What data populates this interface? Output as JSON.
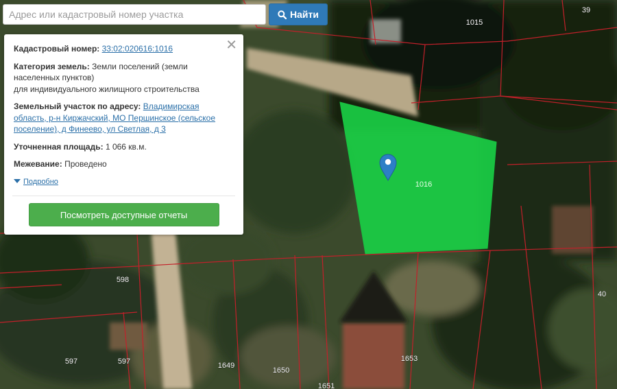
{
  "search": {
    "placeholder": "Адрес или кадастровый номер участка",
    "button_label": "Найти",
    "button_icon": "search-icon"
  },
  "info_panel": {
    "cadastral_label": "Кадастровый номер:",
    "cadastral_number": "33:02:020616:1016",
    "category_label": "Категория земель:",
    "category_line1": "Земли поселений (земли",
    "category_line2": "населенных пунктов)",
    "category_line3": "для индивидуального жилищного строительства",
    "address_label": "Земельный участок по адресу:",
    "address_line1": "Владимирская",
    "address_line2": "область, р-н Киржачский, МО Першинское (сельское",
    "address_line3": "поселение), д Финеево, ул Светлая, д 3",
    "area_label": "Уточненная площадь:",
    "area_value": "1 066 кв.м.",
    "survey_label": "Межевание:",
    "survey_value": "Проведено",
    "details_link": "Подробно",
    "reports_button": "Посмотреть доступные отчеты",
    "close_icon": "close-icon"
  },
  "map": {
    "selected_parcel_label": "1016",
    "parcel_labels": [
      "1015",
      "39",
      "598",
      "597",
      "597",
      "1649",
      "1650",
      "1651",
      "1653",
      "40"
    ],
    "highlight_color": "#19d146",
    "boundary_color": "#c3202a",
    "marker_color": "#2d7fc6",
    "marker_icon": "map-pin-icon"
  }
}
